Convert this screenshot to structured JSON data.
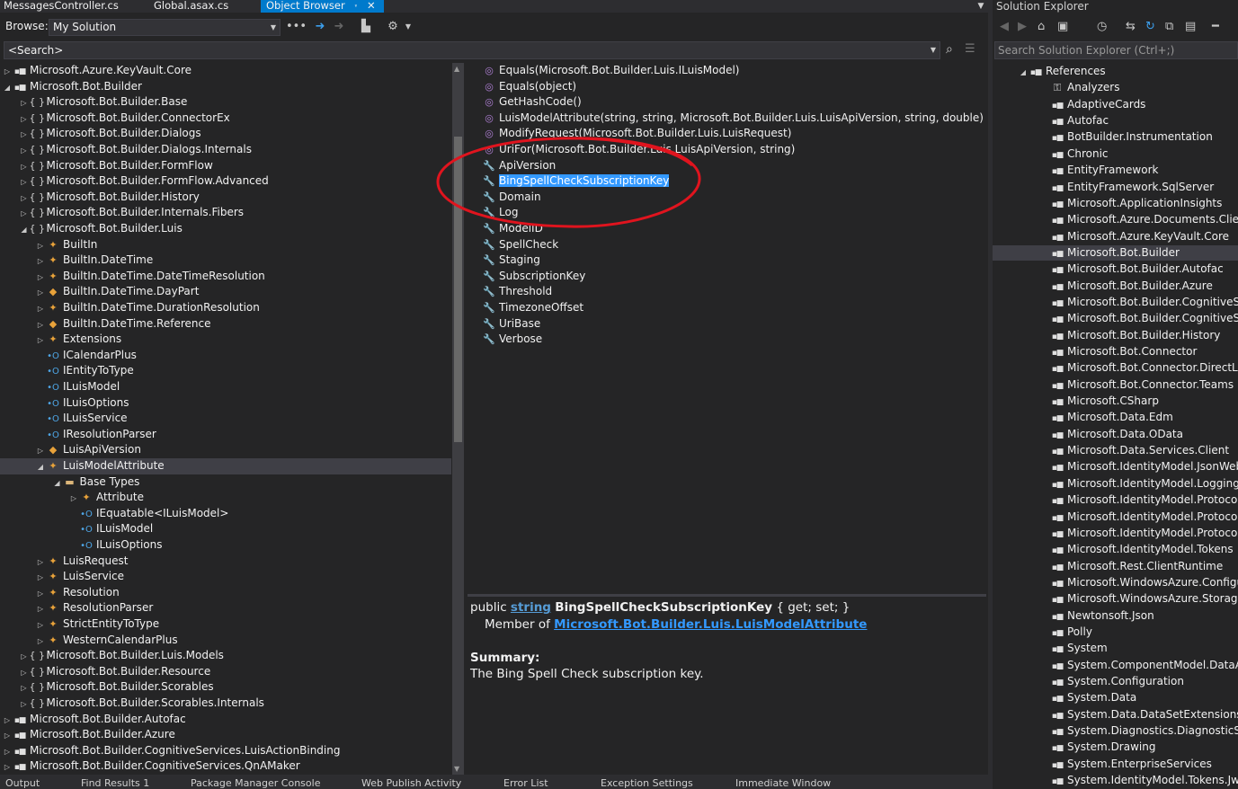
{
  "tabs": [
    {
      "label": "MessagesController.cs",
      "active": false
    },
    {
      "label": "Global.asax.cs",
      "active": false
    },
    {
      "label": "Object Browser",
      "active": true
    }
  ],
  "tab_pin_icon": "pin-icon",
  "tab_close_icon": "close-icon",
  "browse": {
    "label": "Browse:",
    "selected": "My Solution"
  },
  "search": {
    "value": "<Search>"
  },
  "tree": [
    {
      "label": "Microsoft.Azure.KeyVault.Core",
      "indent": 0,
      "icon": "assembly",
      "expander": "collapsed"
    },
    {
      "label": "Microsoft.Bot.Builder",
      "indent": 0,
      "icon": "assembly",
      "expander": "expanded"
    },
    {
      "label": "Microsoft.Bot.Builder.Base",
      "indent": 1,
      "icon": "namespace",
      "expander": "collapsed"
    },
    {
      "label": "Microsoft.Bot.Builder.ConnectorEx",
      "indent": 1,
      "icon": "namespace",
      "expander": "collapsed"
    },
    {
      "label": "Microsoft.Bot.Builder.Dialogs",
      "indent": 1,
      "icon": "namespace",
      "expander": "collapsed"
    },
    {
      "label": "Microsoft.Bot.Builder.Dialogs.Internals",
      "indent": 1,
      "icon": "namespace",
      "expander": "collapsed"
    },
    {
      "label": "Microsoft.Bot.Builder.FormFlow",
      "indent": 1,
      "icon": "namespace",
      "expander": "collapsed"
    },
    {
      "label": "Microsoft.Bot.Builder.FormFlow.Advanced",
      "indent": 1,
      "icon": "namespace",
      "expander": "collapsed"
    },
    {
      "label": "Microsoft.Bot.Builder.History",
      "indent": 1,
      "icon": "namespace",
      "expander": "collapsed"
    },
    {
      "label": "Microsoft.Bot.Builder.Internals.Fibers",
      "indent": 1,
      "icon": "namespace",
      "expander": "collapsed"
    },
    {
      "label": "Microsoft.Bot.Builder.Luis",
      "indent": 1,
      "icon": "namespace",
      "expander": "expanded"
    },
    {
      "label": "BuiltIn",
      "indent": 2,
      "icon": "class",
      "expander": "collapsed"
    },
    {
      "label": "BuiltIn.DateTime",
      "indent": 2,
      "icon": "class",
      "expander": "collapsed"
    },
    {
      "label": "BuiltIn.DateTime.DateTimeResolution",
      "indent": 2,
      "icon": "class",
      "expander": "collapsed"
    },
    {
      "label": "BuiltIn.DateTime.DayPart",
      "indent": 2,
      "icon": "enum",
      "expander": "collapsed"
    },
    {
      "label": "BuiltIn.DateTime.DurationResolution",
      "indent": 2,
      "icon": "class",
      "expander": "collapsed"
    },
    {
      "label": "BuiltIn.DateTime.Reference",
      "indent": 2,
      "icon": "enum",
      "expander": "collapsed"
    },
    {
      "label": "Extensions",
      "indent": 2,
      "icon": "class",
      "expander": "collapsed"
    },
    {
      "label": "ICalendarPlus",
      "indent": 2,
      "icon": "interface",
      "expander": "none"
    },
    {
      "label": "IEntityToType",
      "indent": 2,
      "icon": "interface",
      "expander": "none"
    },
    {
      "label": "ILuisModel",
      "indent": 2,
      "icon": "interface",
      "expander": "none"
    },
    {
      "label": "ILuisOptions",
      "indent": 2,
      "icon": "interface",
      "expander": "none"
    },
    {
      "label": "ILuisService",
      "indent": 2,
      "icon": "interface",
      "expander": "none"
    },
    {
      "label": "IResolutionParser",
      "indent": 2,
      "icon": "interface",
      "expander": "none"
    },
    {
      "label": "LuisApiVersion",
      "indent": 2,
      "icon": "enum",
      "expander": "collapsed"
    },
    {
      "label": "LuisModelAttribute",
      "indent": 2,
      "icon": "class",
      "expander": "expanded",
      "selected": true
    },
    {
      "label": "Base Types",
      "indent": 3,
      "icon": "folder",
      "expander": "expanded"
    },
    {
      "label": "Attribute",
      "indent": 4,
      "icon": "class",
      "expander": "collapsed"
    },
    {
      "label": "IEquatable<ILuisModel>",
      "indent": 4,
      "icon": "interface",
      "expander": "none"
    },
    {
      "label": "ILuisModel",
      "indent": 4,
      "icon": "interface",
      "expander": "none"
    },
    {
      "label": "ILuisOptions",
      "indent": 4,
      "icon": "interface",
      "expander": "none"
    },
    {
      "label": "LuisRequest",
      "indent": 2,
      "icon": "class",
      "expander": "collapsed"
    },
    {
      "label": "LuisService",
      "indent": 2,
      "icon": "class",
      "expander": "collapsed"
    },
    {
      "label": "Resolution",
      "indent": 2,
      "icon": "class",
      "expander": "collapsed"
    },
    {
      "label": "ResolutionParser",
      "indent": 2,
      "icon": "class",
      "expander": "collapsed"
    },
    {
      "label": "StrictEntityToType",
      "indent": 2,
      "icon": "class",
      "expander": "collapsed"
    },
    {
      "label": "WesternCalendarPlus",
      "indent": 2,
      "icon": "class",
      "expander": "collapsed"
    },
    {
      "label": "Microsoft.Bot.Builder.Luis.Models",
      "indent": 1,
      "icon": "namespace",
      "expander": "collapsed"
    },
    {
      "label": "Microsoft.Bot.Builder.Resource",
      "indent": 1,
      "icon": "namespace",
      "expander": "collapsed"
    },
    {
      "label": "Microsoft.Bot.Builder.Scorables",
      "indent": 1,
      "icon": "namespace",
      "expander": "collapsed"
    },
    {
      "label": "Microsoft.Bot.Builder.Scorables.Internals",
      "indent": 1,
      "icon": "namespace",
      "expander": "collapsed"
    },
    {
      "label": "Microsoft.Bot.Builder.Autofac",
      "indent": 0,
      "icon": "assembly",
      "expander": "collapsed"
    },
    {
      "label": "Microsoft.Bot.Builder.Azure",
      "indent": 0,
      "icon": "assembly",
      "expander": "collapsed"
    },
    {
      "label": "Microsoft.Bot.Builder.CognitiveServices.LuisActionBinding",
      "indent": 0,
      "icon": "assembly",
      "expander": "collapsed"
    },
    {
      "label": "Microsoft.Bot.Builder.CognitiveServices.QnAMaker",
      "indent": 0,
      "icon": "assembly",
      "expander": "collapsed"
    }
  ],
  "members": [
    {
      "label": "Equals(Microsoft.Bot.Builder.Luis.ILuisModel)",
      "icon": "method"
    },
    {
      "label": "Equals(object)",
      "icon": "method"
    },
    {
      "label": "GetHashCode()",
      "icon": "method"
    },
    {
      "label": "LuisModelAttribute(string, string, Microsoft.Bot.Builder.Luis.LuisApiVersion, string, double)",
      "icon": "method"
    },
    {
      "label": "ModifyRequest(Microsoft.Bot.Builder.Luis.LuisRequest)",
      "icon": "method"
    },
    {
      "label": "UriFor(Microsoft.Bot.Builder.Luis.LuisApiVersion, string)",
      "icon": "method"
    },
    {
      "label": "ApiVersion",
      "icon": "property"
    },
    {
      "label": "BingSpellCheckSubscriptionKey",
      "icon": "property",
      "highlighted": true
    },
    {
      "label": "Domain",
      "icon": "property"
    },
    {
      "label": "Log",
      "icon": "property"
    },
    {
      "label": "ModelID",
      "icon": "property"
    },
    {
      "label": "SpellCheck",
      "icon": "property"
    },
    {
      "label": "Staging",
      "icon": "property"
    },
    {
      "label": "SubscriptionKey",
      "icon": "property"
    },
    {
      "label": "Threshold",
      "icon": "property"
    },
    {
      "label": "TimezoneOffset",
      "icon": "property"
    },
    {
      "label": "UriBase",
      "icon": "property"
    },
    {
      "label": "Verbose",
      "icon": "property"
    }
  ],
  "description": {
    "modifier": "public",
    "type": "string",
    "name": "BingSpellCheckSubscriptionKey",
    "accessors": "{ get; set; }",
    "member_of_label": "Member of",
    "member_of": "Microsoft.Bot.Builder.Luis.LuisModelAttribute",
    "summary_label": "Summary:",
    "summary": "The Bing Spell Check subscription key."
  },
  "bottom_tabs": [
    "Output",
    "Find Results 1",
    "Package Manager Console",
    "Web Publish Activity",
    "Error List",
    "Exception Settings",
    "Immediate Window"
  ],
  "solution_explorer": {
    "title": "Solution Explorer",
    "search_placeholder": "Search Solution Explorer (Ctrl+;)",
    "references_label": "References",
    "items": [
      {
        "label": "Analyzers",
        "icon": "analyzer"
      },
      {
        "label": "AdaptiveCards",
        "icon": "assembly"
      },
      {
        "label": "Autofac",
        "icon": "assembly"
      },
      {
        "label": "BotBuilder.Instrumentation",
        "icon": "assembly"
      },
      {
        "label": "Chronic",
        "icon": "assembly"
      },
      {
        "label": "EntityFramework",
        "icon": "assembly"
      },
      {
        "label": "EntityFramework.SqlServer",
        "icon": "assembly"
      },
      {
        "label": "Microsoft.ApplicationInsights",
        "icon": "assembly"
      },
      {
        "label": "Microsoft.Azure.Documents.Client",
        "icon": "assembly"
      },
      {
        "label": "Microsoft.Azure.KeyVault.Core",
        "icon": "assembly"
      },
      {
        "label": "Microsoft.Bot.Builder",
        "icon": "assembly",
        "selected": true
      },
      {
        "label": "Microsoft.Bot.Builder.Autofac",
        "icon": "assembly"
      },
      {
        "label": "Microsoft.Bot.Builder.Azure",
        "icon": "assembly"
      },
      {
        "label": "Microsoft.Bot.Builder.CognitiveServ",
        "icon": "assembly"
      },
      {
        "label": "Microsoft.Bot.Builder.CognitiveServ",
        "icon": "assembly"
      },
      {
        "label": "Microsoft.Bot.Builder.History",
        "icon": "assembly"
      },
      {
        "label": "Microsoft.Bot.Connector",
        "icon": "assembly"
      },
      {
        "label": "Microsoft.Bot.Connector.DirectLine",
        "icon": "assembly"
      },
      {
        "label": "Microsoft.Bot.Connector.Teams",
        "icon": "assembly"
      },
      {
        "label": "Microsoft.CSharp",
        "icon": "assembly"
      },
      {
        "label": "Microsoft.Data.Edm",
        "icon": "assembly"
      },
      {
        "label": "Microsoft.Data.OData",
        "icon": "assembly"
      },
      {
        "label": "Microsoft.Data.Services.Client",
        "icon": "assembly"
      },
      {
        "label": "Microsoft.IdentityModel.JsonWebTo",
        "icon": "assembly"
      },
      {
        "label": "Microsoft.IdentityModel.Logging",
        "icon": "assembly"
      },
      {
        "label": "Microsoft.IdentityModel.Protocol.E",
        "icon": "assembly"
      },
      {
        "label": "Microsoft.IdentityModel.Protocols",
        "icon": "assembly"
      },
      {
        "label": "Microsoft.IdentityModel.Protocols.O",
        "icon": "assembly"
      },
      {
        "label": "Microsoft.IdentityModel.Tokens",
        "icon": "assembly"
      },
      {
        "label": "Microsoft.Rest.ClientRuntime",
        "icon": "assembly"
      },
      {
        "label": "Microsoft.WindowsAzure.Configura",
        "icon": "assembly"
      },
      {
        "label": "Microsoft.WindowsAzure.Storage",
        "icon": "assembly"
      },
      {
        "label": "Newtonsoft.Json",
        "icon": "assembly"
      },
      {
        "label": "Polly",
        "icon": "assembly"
      },
      {
        "label": "System",
        "icon": "assembly"
      },
      {
        "label": "System.ComponentModel.DataAnn",
        "icon": "assembly"
      },
      {
        "label": "System.Configuration",
        "icon": "assembly"
      },
      {
        "label": "System.Data",
        "icon": "assembly"
      },
      {
        "label": "System.Data.DataSetExtensions",
        "icon": "assembly"
      },
      {
        "label": "System.Diagnostics.DiagnosticSour",
        "icon": "assembly"
      },
      {
        "label": "System.Drawing",
        "icon": "assembly"
      },
      {
        "label": "System.EnterpriseServices",
        "icon": "assembly"
      },
      {
        "label": "System.IdentityModel.Tokens.Jwt",
        "icon": "assembly"
      }
    ]
  },
  "colors": {
    "accent": "#007acc",
    "highlight": "#3399ff",
    "annotation": "#e0141e",
    "background": "#252526"
  }
}
